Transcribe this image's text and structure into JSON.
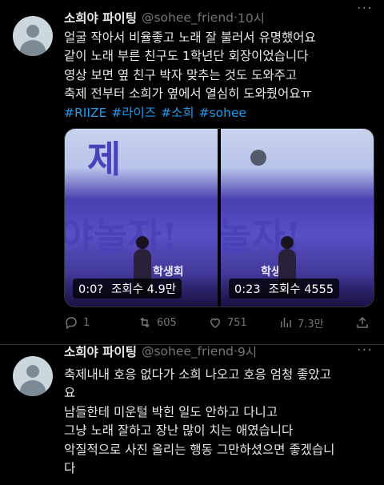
{
  "tweets": [
    {
      "author": "소희야 파이팅",
      "handle": "@sohee_friend",
      "separator": "·",
      "time": "10시",
      "lines": [
        "얼굴 작아서 비율좋고 노래 잘 불러서 유명했어요",
        "같이 노래 부른 친구도 1학년단 회장이었습니다",
        "영상 보면 옆 친구 박자 맞추는 것도 도와주고",
        "축제 전부터 소희가 옆에서 열심히 도와줬어요ㅠ"
      ],
      "hashtags": [
        "#RIIZE",
        "#라이즈",
        "#소희",
        "#sohee"
      ],
      "media": [
        {
          "time": "0:0?",
          "views": "조회수 4.9만",
          "banner_text": "제",
          "sign_text": "야놀자!",
          "sub_text": "학생회"
        },
        {
          "time": "0:23",
          "views": "조회수 4555",
          "banner_text": "",
          "sign_text": "놀자!",
          "sub_text": "학생회"
        }
      ],
      "stats": {
        "replies": "1",
        "retweets": "605",
        "likes": "751",
        "views": "7.3만"
      }
    },
    {
      "author": "소희야 파이팅",
      "handle": "@sohee_friend",
      "separator": "·",
      "time": "9시",
      "lines": [
        "축제내내 호응 없다가 소희 나오고 호응 엄청 좋았고",
        "요",
        "남들한테 미운털 박힌 일도 안하고 다니고",
        "그냥 노래 잘하고 장난 많이 치는 애였습니다",
        "악질적으로 사진 올리는 행동 그만하셨으면 좋겠습니",
        "다"
      ]
    }
  ],
  "colors": {
    "accent": "#1d9bf0",
    "muted": "#71767b",
    "text": "#e7e9ea",
    "bg": "#000000"
  },
  "icons": [
    "reply-icon",
    "retweet-icon",
    "like-icon",
    "views-icon",
    "share-icon",
    "more-icon",
    "gif-icon"
  ]
}
